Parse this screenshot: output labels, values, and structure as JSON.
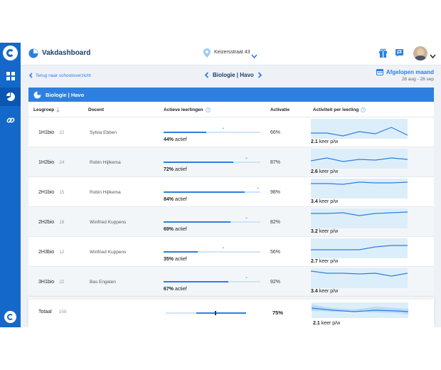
{
  "app": {
    "title": "Vakdashboard"
  },
  "location": {
    "name": "Keizersstraat 43"
  },
  "subnav": {
    "back_label": "Terug naar schooloverzicht",
    "course": "Biologie | Havo",
    "period_label": "Afgelopen maand",
    "period_range": "28 aug - 28 sep"
  },
  "card": {
    "title": "Biologie | Havo"
  },
  "columns": {
    "group": "Lesgroep",
    "teacher": "Docent",
    "active": "Actieve leerlingen",
    "activation": "Activatie",
    "activity": "Activiteit per leerling"
  },
  "rows": [
    {
      "group": "1H1bio",
      "count": "22",
      "teacher": "Sylvia Ebben",
      "active_pct": "44%",
      "active_suffix": "actief",
      "active_value": 0.44,
      "mark_value": 0.62,
      "activation": "66%",
      "activity_num": "2.1",
      "activity_suffix": "keer p/w",
      "spark": [
        2.0,
        2.0,
        1.6,
        2.2,
        1.9,
        2.8,
        1.7
      ]
    },
    {
      "group": "1H2bio",
      "count": "24",
      "teacher": "Robin Hijlkema",
      "active_pct": "72%",
      "active_suffix": "actief",
      "active_value": 0.72,
      "mark_value": 0.86,
      "activation": "87%",
      "activity_num": "2.6",
      "activity_suffix": "keer p/w",
      "spark": [
        2.3,
        2.7,
        2.2,
        2.5,
        2.4,
        2.7,
        2.5
      ]
    },
    {
      "group": "2H1bio",
      "count": "15",
      "teacher": "Robin Hijlkema",
      "active_pct": "84%",
      "active_suffix": "actief",
      "active_value": 0.84,
      "mark_value": 0.98,
      "activation": "98%",
      "activity_num": "3.4",
      "activity_suffix": "keer p/w",
      "spark": [
        3.3,
        3.3,
        3.2,
        3.5,
        3.4,
        3.4,
        3.5
      ]
    },
    {
      "group": "2H2bio",
      "count": "16",
      "teacher": "Winfried Kuppens",
      "active_pct": "69%",
      "active_suffix": "actief",
      "active_value": 0.69,
      "mark_value": 0.86,
      "activation": "82%",
      "activity_num": "3.2",
      "activity_suffix": "keer p/w",
      "spark": [
        3.3,
        3.3,
        3.4,
        3.0,
        3.3,
        3.4,
        3.5
      ]
    },
    {
      "group": "2H3bio",
      "count": "12",
      "teacher": "Winfried Kuppens",
      "active_pct": "35%",
      "active_suffix": "actief",
      "active_value": 0.35,
      "mark_value": 0.62,
      "activation": "56%",
      "activity_num": "2.7",
      "activity_suffix": "keer p/w",
      "spark": [
        2.4,
        2.4,
        2.4,
        2.4,
        2.8,
        3.0,
        3.0
      ]
    },
    {
      "group": "3H1bio",
      "count": "22",
      "teacher": "Bas Engelen",
      "active_pct": "67%",
      "active_suffix": "actief",
      "active_value": 0.67,
      "mark_value": 0.86,
      "activation": "92%",
      "activity_num": "3.4",
      "activity_suffix": "keer p/w",
      "spark": [
        3.6,
        3.3,
        3.3,
        3.2,
        3.3,
        2.9,
        3.3
      ]
    }
  ],
  "total": {
    "label": "Totaal",
    "count": "159",
    "activation": "75%",
    "activity_num": "2.1",
    "activity_suffix": "keer p/w"
  },
  "colors": {
    "rail": "#1468c9",
    "accent": "#2e7fe0",
    "bar_bg": "#cfe3f7",
    "spark_bg": "#ddeefb"
  }
}
